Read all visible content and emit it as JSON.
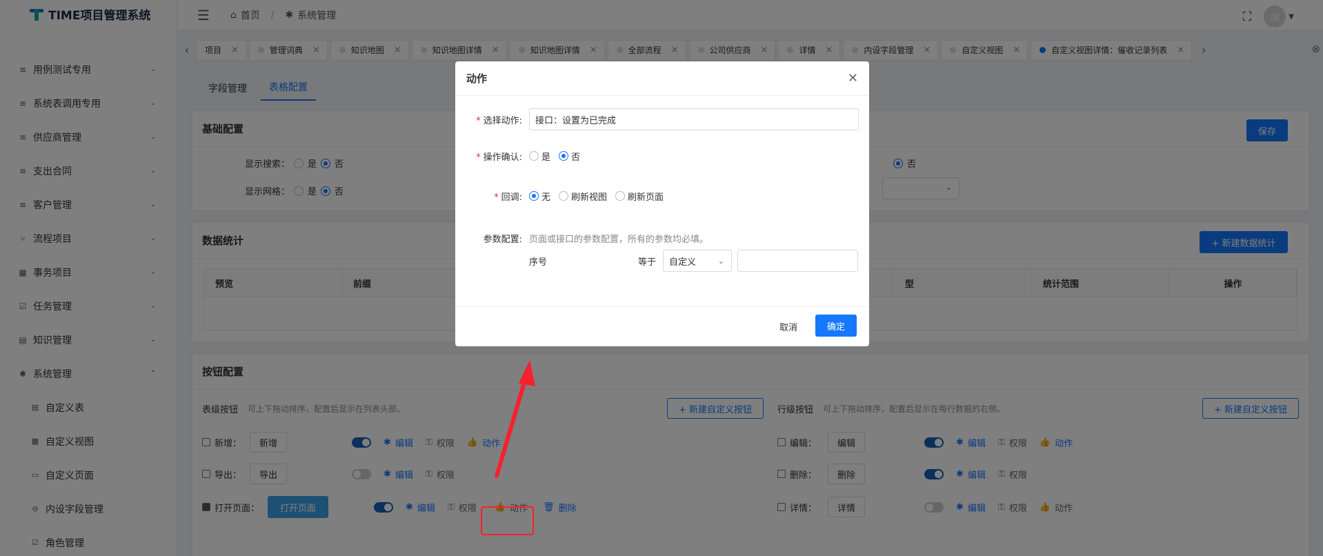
{
  "app": {
    "title": "TIME项目管理系统",
    "avatar_text": "测"
  },
  "sidebar": {
    "items": [
      {
        "icon": "≡",
        "label": "用例测试专用",
        "chev": "⌄"
      },
      {
        "icon": "≡",
        "label": "系统表调用专用",
        "chev": "⌄"
      },
      {
        "icon": "≡",
        "label": "供应商管理",
        "chev": "⌄"
      },
      {
        "icon": "≡",
        "label": "支出合同",
        "chev": "⌄"
      },
      {
        "icon": "≡",
        "label": "客户管理",
        "chev": "⌄"
      },
      {
        "icon": "⑂",
        "label": "流程项目",
        "chev": "⌄"
      },
      {
        "icon": "▦",
        "label": "事务项目",
        "chev": "⌄"
      },
      {
        "icon": "☑",
        "label": "任务管理",
        "chev": "⌄"
      },
      {
        "icon": "▤",
        "label": "知识管理",
        "chev": "⌄"
      },
      {
        "icon": "✱",
        "label": "系统管理",
        "chev": "⌃"
      }
    ],
    "subitems": [
      {
        "icon": "▤",
        "label": "自定义表"
      },
      {
        "icon": "▩",
        "label": "自定义视图"
      },
      {
        "icon": "▭",
        "label": "自定义页面"
      },
      {
        "icon": "⊖",
        "label": "内设字段管理"
      },
      {
        "icon": "☑",
        "label": "角色管理"
      }
    ]
  },
  "topbar": {
    "home": "首页",
    "current": "系统管理"
  },
  "tabs": [
    {
      "label": "项目"
    },
    {
      "label": "管理词典"
    },
    {
      "label": "知识地图"
    },
    {
      "label": "知识地图详情"
    },
    {
      "label": "知识地图详情"
    },
    {
      "label": "全部流程"
    },
    {
      "label": "公司供应商"
    },
    {
      "label": "详情"
    },
    {
      "label": "内设字段管理"
    },
    {
      "label": "自定义视图"
    },
    {
      "label": "自定义视图详情：催收记录列表"
    }
  ],
  "subtabs": [
    "字段管理",
    "表格配置"
  ],
  "basic": {
    "title": "基础配置",
    "save": "保存",
    "show_search": "显示搜索：",
    "show_grid": "显示网格：",
    "yes": "是",
    "no": "否"
  },
  "stats": {
    "title": "数据统计",
    "new_btn": "+ 新建数据统计",
    "columns": [
      "预览",
      "前缀",
      "",
      "",
      "",
      "型",
      "统计范围",
      "操作"
    ]
  },
  "buttons": {
    "title": "按钮配置",
    "table_level": "表级按钮",
    "table_hint": "可上下拖动排序，配置后显示在列表头部。",
    "row_level": "行级按钮",
    "row_hint": "可上下拖动排序，配置后显示在每行数据的右侧。",
    "new_custom": "+ 新建自定义按钮",
    "edit": "编辑",
    "perm": "权限",
    "action": "动作",
    "delete": "删除",
    "left_rows": [
      {
        "label": "新增：",
        "btn": "新增"
      },
      {
        "label": "导出：",
        "btn": "导出"
      },
      {
        "label": "打开页面：",
        "btn": "打开页面"
      }
    ],
    "right_rows": [
      {
        "label": "编辑：",
        "btn": "编辑"
      },
      {
        "label": "删除：",
        "btn": "删除"
      },
      {
        "label": "详情：",
        "btn": "详情"
      }
    ]
  },
  "dialog": {
    "title": "动作",
    "select_action_label": "选择动作:",
    "select_action_value": "接口：设置为已完成",
    "confirm_label": "操作确认:",
    "confirm_yes": "是",
    "confirm_no": "否",
    "callback_label": "回调:",
    "cb_none": "无",
    "cb_refresh_view": "刷新视图",
    "cb_refresh_page": "刷新页面",
    "param_label": "参数配置:",
    "param_hint": "页面或接口的参数配置，所有的参数均必填。",
    "param_name": "序号",
    "param_op": "等于",
    "param_type": "自定义",
    "cancel": "取消",
    "ok": "确定"
  },
  "colors": {
    "primary": "#1677ff",
    "annotation": "#f5222d"
  }
}
